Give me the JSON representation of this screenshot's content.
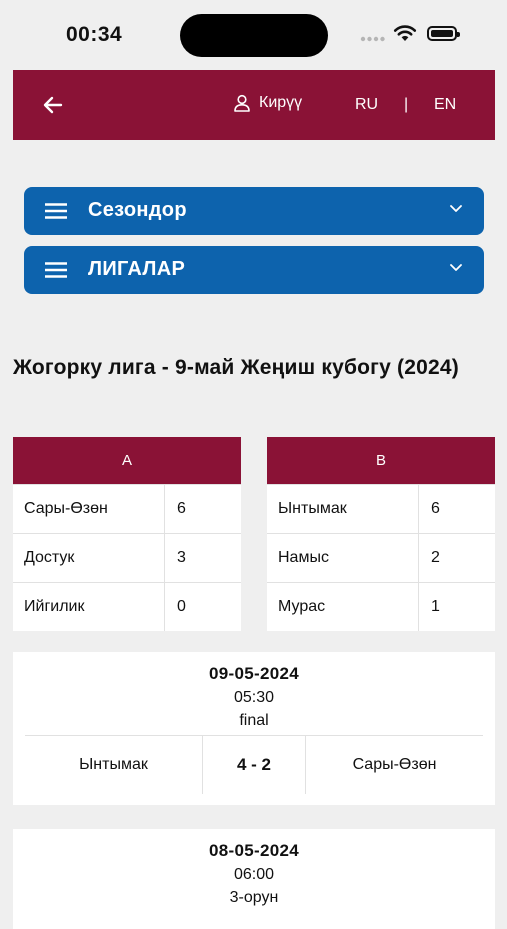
{
  "status_bar": {
    "time": "00:34"
  },
  "header": {
    "login_label": "Кирүү",
    "lang_ru": "RU",
    "lang_sep": "|",
    "lang_en": "EN"
  },
  "dropdowns": {
    "seasons": "Сезондор",
    "leagues": "ЛИГАЛАР"
  },
  "page_title": "Жогорку лига - 9-май Жеңиш кубогу (2024)",
  "groups": [
    {
      "name": "A",
      "rows": [
        {
          "team": "Сары-Өзөн",
          "points": "6"
        },
        {
          "team": "Достук",
          "points": "3"
        },
        {
          "team": "Ийгилик",
          "points": "0"
        }
      ]
    },
    {
      "name": "B",
      "rows": [
        {
          "team": "Ынтымак",
          "points": "6"
        },
        {
          "team": "Намыс",
          "points": "2"
        },
        {
          "team": "Мурас",
          "points": "1"
        }
      ]
    }
  ],
  "matches": [
    {
      "date": "09-05-2024",
      "time": "05:30",
      "stage": "final",
      "home": "Ынтымак",
      "score": "4 - 2",
      "away": "Сары-Өзөн"
    },
    {
      "date": "08-05-2024",
      "time": "06:00",
      "stage": "3-орун"
    }
  ],
  "colors": {
    "header_bg": "#8a1236",
    "dropdown_bg": "#0d63ad",
    "page_bg": "#efefef"
  },
  "icons": {
    "back": "arrow-left-icon",
    "user": "user-icon",
    "menu": "hamburger-icon",
    "chevron": "chevron-down-icon"
  }
}
